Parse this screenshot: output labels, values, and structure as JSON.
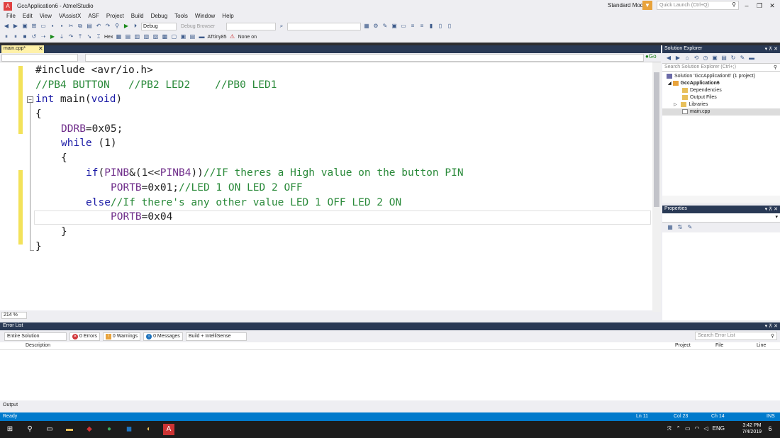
{
  "window": {
    "title": "GccApplication6 - AtmelStudio",
    "mode_label": "Standard Mode",
    "quick_launch_placeholder": "Quick Launch (Ctrl+Q)",
    "logo": "A"
  },
  "menu": [
    "File",
    "Edit",
    "View",
    "VAssistX",
    "ASF",
    "Project",
    "Build",
    "Debug",
    "Tools",
    "Window",
    "Help"
  ],
  "toolbar": {
    "config": "Debug",
    "debug_browser": "Debug Browser",
    "hex_label": "Hex",
    "device": "ATtiny85",
    "tool": "None on"
  },
  "editor": {
    "tab_label": "main.cpp*",
    "go_label": "Go",
    "zoom": "214 %",
    "lines": {
      "l1": "#include <avr/io.h>",
      "l2": "//PB4 BUTTON   //PB2 LED2    //PB0 LED1",
      "l3_kw": "int",
      "l3_rest": " main(",
      "l3_kw2": "void",
      "l3_end": ")",
      "l4": "{",
      "l5_mac": "DDRB",
      "l5_rest": "=0x05;",
      "l6_kw": "while",
      "l6_rest": " (1)",
      "l7": "{",
      "l8_kw": "if",
      "l8_a": "(",
      "l8_mac1": "PINB",
      "l8_b": "&(1<<",
      "l8_mac2": "PINB4",
      "l8_c": "))",
      "l8_cm": "//IF theres a High value on the button PIN",
      "l9_mac": "PORTB",
      "l9_rest": "=0x01;",
      "l9_cm": "//LED 1 ON LED 2 OFF",
      "l10_kw": "else",
      "l10_cm": "//If there's any other value LED 1 OFF LED 2 ON",
      "l11_mac": "PORTB",
      "l11_rest": "=0x04",
      "l12": "}",
      "l13": "}"
    }
  },
  "solution_explorer": {
    "title": "Solution Explorer",
    "search_placeholder": "Search Solution Explorer (Ctrl+;)",
    "items": [
      {
        "label": "Solution 'GccApplication6' (1 project)"
      },
      {
        "label": "GccApplication6"
      },
      {
        "label": "Dependencies"
      },
      {
        "label": "Output Files"
      },
      {
        "label": "Libraries"
      },
      {
        "label": "main.cpp"
      }
    ]
  },
  "properties": {
    "title": "Properties"
  },
  "error_list": {
    "title": "Error List",
    "scope": "Entire Solution",
    "errors": "0 Errors",
    "warnings": "0 Warnings",
    "messages": "0 Messages",
    "build_filter": "Build + IntelliSense",
    "search_placeholder": "Search Error List",
    "columns": [
      "Description",
      "Project",
      "File",
      "Line"
    ]
  },
  "output_tab": "Output",
  "status": {
    "ready": "Ready",
    "ln": "Ln 11",
    "col": "Col 23",
    "ch": "Ch 14",
    "ins": "INS"
  },
  "taskbar": {
    "time": "3:42 PM",
    "date": "7/4/2019",
    "lang": "ENG",
    "notif_count": "6"
  },
  "colors": {
    "keyword": "#1a1aa6",
    "macro": "#6f2d8a",
    "comment": "#2a8a3a",
    "status_bar": "#007acc",
    "panel_header": "#293955"
  }
}
